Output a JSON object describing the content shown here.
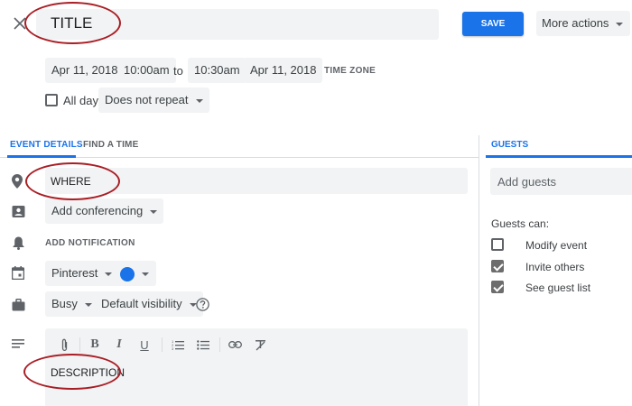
{
  "header": {
    "title_value": "TITLE",
    "save_label": "SAVE",
    "more_actions_label": "More actions"
  },
  "datetime": {
    "start_date": "Apr 11, 2018",
    "start_time": "10:00am",
    "to_label": "to",
    "end_time": "10:30am",
    "end_date": "Apr 11, 2018",
    "timezone_label": "TIME ZONE",
    "all_day_label": "All day",
    "repeat_label": "Does not repeat"
  },
  "tabs": {
    "event_details": "EVENT DETAILS",
    "find_a_time": "FIND A TIME"
  },
  "details": {
    "location_value": "WHERE",
    "conferencing_label": "Add conferencing",
    "add_notification_label": "ADD NOTIFICATION",
    "calendar_label": "Pinterest",
    "event_color": "#1a73e8",
    "busy_label": "Busy",
    "visibility_label": "Default visibility",
    "description_value": "DESCRIPTION"
  },
  "guests": {
    "tab_label": "GUESTS",
    "add_placeholder": "Add guests",
    "guests_can_label": "Guests can:",
    "permissions": [
      {
        "label": "Modify event",
        "checked": false
      },
      {
        "label": "Invite others",
        "checked": true
      },
      {
        "label": "See guest list",
        "checked": true
      }
    ]
  },
  "colors": {
    "accent": "#1a73e8",
    "annotation": "#a91e25"
  }
}
